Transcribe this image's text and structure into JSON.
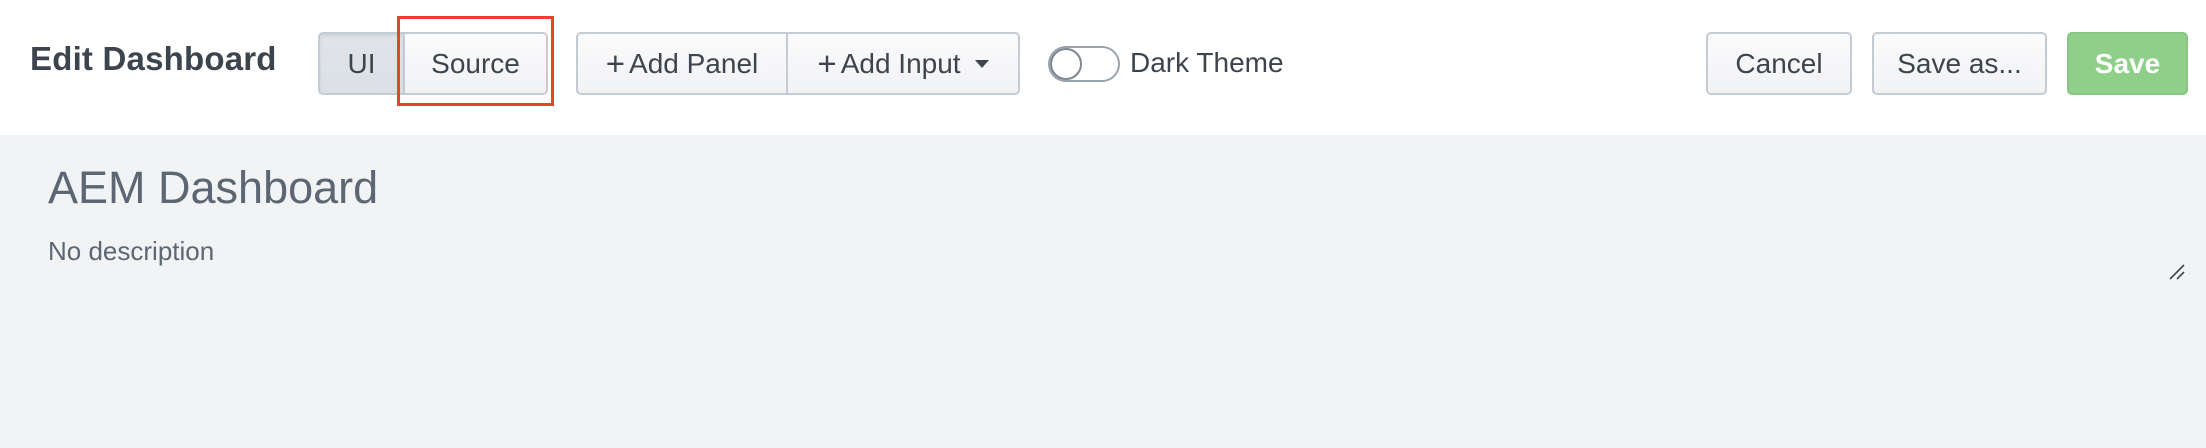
{
  "toolbar": {
    "title": "Edit Dashboard",
    "mode_tabs": [
      {
        "label": "UI",
        "active": true
      },
      {
        "label": "Source",
        "active": false
      }
    ],
    "add_panel_label": "Add Panel",
    "add_input_label": "Add Input",
    "plus_glyph": "+",
    "dark_theme": {
      "label": "Dark Theme",
      "enabled": false
    },
    "cancel_label": "Cancel",
    "save_as_label": "Save as...",
    "save_label": "Save"
  },
  "dashboard": {
    "title": "AEM Dashboard",
    "description": "No description"
  },
  "colors": {
    "highlight": "#e8412d",
    "save_button": "#8fcf8a",
    "content_background": "#f2f3f5"
  },
  "icons": [
    "caret-down-icon",
    "plus-icon",
    "resize-handle-icon"
  ]
}
